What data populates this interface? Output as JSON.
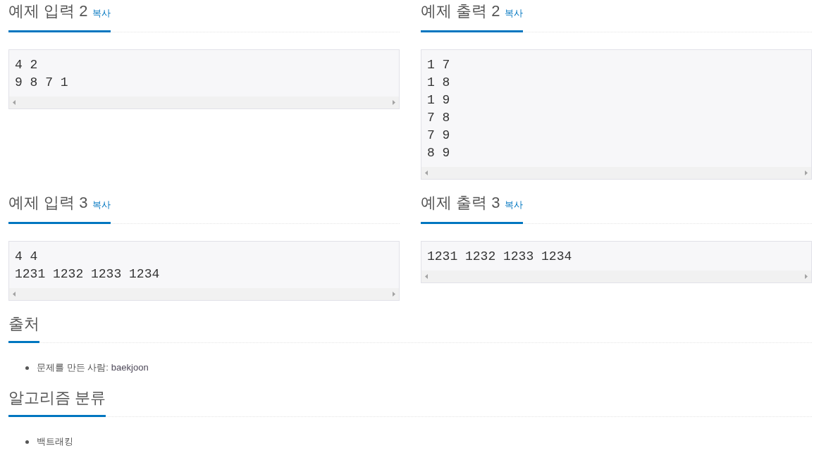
{
  "examples": [
    {
      "input": {
        "title": "예제 입력 2",
        "copy": "복사",
        "lines": [
          "4 2",
          "9 8 7 1"
        ]
      },
      "output": {
        "title": "예제 출력 2",
        "copy": "복사",
        "lines": [
          "1 7",
          "1 8",
          "1 9",
          "7 8",
          "7 9",
          "8 9"
        ]
      }
    },
    {
      "input": {
        "title": "예제 입력 3",
        "copy": "복사",
        "lines": [
          "4 4",
          "1231 1232 1233 1234"
        ]
      },
      "output": {
        "title": "예제 출력 3",
        "copy": "복사",
        "lines": [
          "1231 1232 1233 1234"
        ]
      }
    }
  ],
  "source": {
    "title": "출처",
    "items": [
      {
        "label": "문제를 만든 사람:",
        "link": "baekjoon"
      }
    ]
  },
  "algorithm_tags": {
    "title": "알고리즘 분류",
    "items": [
      "백트래킹"
    ]
  }
}
